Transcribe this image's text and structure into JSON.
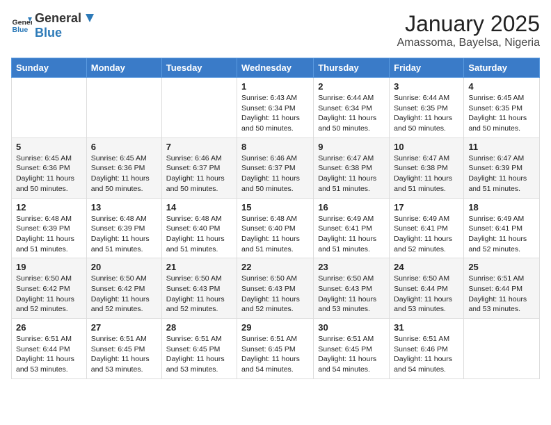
{
  "header": {
    "logo_general": "General",
    "logo_blue": "Blue",
    "month_year": "January 2025",
    "location": "Amassoma, Bayelsa, Nigeria"
  },
  "days_of_week": [
    "Sunday",
    "Monday",
    "Tuesday",
    "Wednesday",
    "Thursday",
    "Friday",
    "Saturday"
  ],
  "weeks": [
    [
      {
        "day": "",
        "info": ""
      },
      {
        "day": "",
        "info": ""
      },
      {
        "day": "",
        "info": ""
      },
      {
        "day": "1",
        "info": "Sunrise: 6:43 AM\nSunset: 6:34 PM\nDaylight: 11 hours\nand 50 minutes."
      },
      {
        "day": "2",
        "info": "Sunrise: 6:44 AM\nSunset: 6:34 PM\nDaylight: 11 hours\nand 50 minutes."
      },
      {
        "day": "3",
        "info": "Sunrise: 6:44 AM\nSunset: 6:35 PM\nDaylight: 11 hours\nand 50 minutes."
      },
      {
        "day": "4",
        "info": "Sunrise: 6:45 AM\nSunset: 6:35 PM\nDaylight: 11 hours\nand 50 minutes."
      }
    ],
    [
      {
        "day": "5",
        "info": "Sunrise: 6:45 AM\nSunset: 6:36 PM\nDaylight: 11 hours\nand 50 minutes."
      },
      {
        "day": "6",
        "info": "Sunrise: 6:45 AM\nSunset: 6:36 PM\nDaylight: 11 hours\nand 50 minutes."
      },
      {
        "day": "7",
        "info": "Sunrise: 6:46 AM\nSunset: 6:37 PM\nDaylight: 11 hours\nand 50 minutes."
      },
      {
        "day": "8",
        "info": "Sunrise: 6:46 AM\nSunset: 6:37 PM\nDaylight: 11 hours\nand 50 minutes."
      },
      {
        "day": "9",
        "info": "Sunrise: 6:47 AM\nSunset: 6:38 PM\nDaylight: 11 hours\nand 51 minutes."
      },
      {
        "day": "10",
        "info": "Sunrise: 6:47 AM\nSunset: 6:38 PM\nDaylight: 11 hours\nand 51 minutes."
      },
      {
        "day": "11",
        "info": "Sunrise: 6:47 AM\nSunset: 6:39 PM\nDaylight: 11 hours\nand 51 minutes."
      }
    ],
    [
      {
        "day": "12",
        "info": "Sunrise: 6:48 AM\nSunset: 6:39 PM\nDaylight: 11 hours\nand 51 minutes."
      },
      {
        "day": "13",
        "info": "Sunrise: 6:48 AM\nSunset: 6:39 PM\nDaylight: 11 hours\nand 51 minutes."
      },
      {
        "day": "14",
        "info": "Sunrise: 6:48 AM\nSunset: 6:40 PM\nDaylight: 11 hours\nand 51 minutes."
      },
      {
        "day": "15",
        "info": "Sunrise: 6:48 AM\nSunset: 6:40 PM\nDaylight: 11 hours\nand 51 minutes."
      },
      {
        "day": "16",
        "info": "Sunrise: 6:49 AM\nSunset: 6:41 PM\nDaylight: 11 hours\nand 51 minutes."
      },
      {
        "day": "17",
        "info": "Sunrise: 6:49 AM\nSunset: 6:41 PM\nDaylight: 11 hours\nand 52 minutes."
      },
      {
        "day": "18",
        "info": "Sunrise: 6:49 AM\nSunset: 6:41 PM\nDaylight: 11 hours\nand 52 minutes."
      }
    ],
    [
      {
        "day": "19",
        "info": "Sunrise: 6:50 AM\nSunset: 6:42 PM\nDaylight: 11 hours\nand 52 minutes."
      },
      {
        "day": "20",
        "info": "Sunrise: 6:50 AM\nSunset: 6:42 PM\nDaylight: 11 hours\nand 52 minutes."
      },
      {
        "day": "21",
        "info": "Sunrise: 6:50 AM\nSunset: 6:43 PM\nDaylight: 11 hours\nand 52 minutes."
      },
      {
        "day": "22",
        "info": "Sunrise: 6:50 AM\nSunset: 6:43 PM\nDaylight: 11 hours\nand 52 minutes."
      },
      {
        "day": "23",
        "info": "Sunrise: 6:50 AM\nSunset: 6:43 PM\nDaylight: 11 hours\nand 53 minutes."
      },
      {
        "day": "24",
        "info": "Sunrise: 6:50 AM\nSunset: 6:44 PM\nDaylight: 11 hours\nand 53 minutes."
      },
      {
        "day": "25",
        "info": "Sunrise: 6:51 AM\nSunset: 6:44 PM\nDaylight: 11 hours\nand 53 minutes."
      }
    ],
    [
      {
        "day": "26",
        "info": "Sunrise: 6:51 AM\nSunset: 6:44 PM\nDaylight: 11 hours\nand 53 minutes."
      },
      {
        "day": "27",
        "info": "Sunrise: 6:51 AM\nSunset: 6:45 PM\nDaylight: 11 hours\nand 53 minutes."
      },
      {
        "day": "28",
        "info": "Sunrise: 6:51 AM\nSunset: 6:45 PM\nDaylight: 11 hours\nand 53 minutes."
      },
      {
        "day": "29",
        "info": "Sunrise: 6:51 AM\nSunset: 6:45 PM\nDaylight: 11 hours\nand 54 minutes."
      },
      {
        "day": "30",
        "info": "Sunrise: 6:51 AM\nSunset: 6:45 PM\nDaylight: 11 hours\nand 54 minutes."
      },
      {
        "day": "31",
        "info": "Sunrise: 6:51 AM\nSunset: 6:46 PM\nDaylight: 11 hours\nand 54 minutes."
      },
      {
        "day": "",
        "info": ""
      }
    ]
  ],
  "row_classes": [
    "row-1",
    "row-2",
    "row-3",
    "row-4",
    "row-5",
    "row-6"
  ]
}
